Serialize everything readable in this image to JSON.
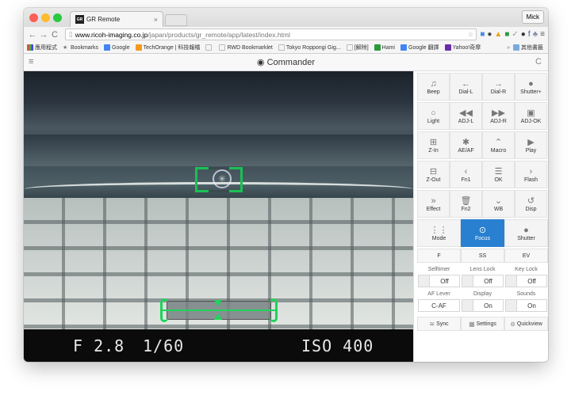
{
  "browser": {
    "tab_title": "GR Remote",
    "tab_favicon": "GR",
    "user": "Mick",
    "url_host": "www.ricoh-imaging.co.jp",
    "url_path": "/japan/products/gr_remote/app/latest/index.html",
    "bookmarks": [
      "應用程式",
      "Bookmarks",
      "Google",
      "TechOrange | 科技報橘",
      "",
      "RWD Bookmarklet",
      "Tokyo Roppongi Gig...",
      "[解除]",
      "Hami",
      "Google 翻譯",
      "Yahoo!奇摩",
      "其他書籤"
    ]
  },
  "app": {
    "title": "Commander"
  },
  "camera": {
    "aperture": "F 2.8",
    "shutter": "1/60",
    "iso": "ISO 400"
  },
  "controls": {
    "rows": [
      [
        {
          "label": "Beep",
          "icon": "bell-icon"
        },
        {
          "label": "Dial-L",
          "icon": "arrow-left-icon"
        },
        {
          "label": "Dial-R",
          "icon": "arrow-right-icon"
        },
        {
          "label": "Shutter+",
          "icon": "circle-icon"
        }
      ],
      [
        {
          "label": "Light",
          "icon": "bulb-icon"
        },
        {
          "label": "ADJ-L",
          "icon": "rewind-icon"
        },
        {
          "label": "ADJ-R",
          "icon": "fast-forward-icon"
        },
        {
          "label": "ADJ-OK",
          "icon": "square-down-icon"
        }
      ],
      [
        {
          "label": "Z-In",
          "icon": "plus-square-icon"
        },
        {
          "label": "AE/AF",
          "icon": "asterisk-icon"
        },
        {
          "label": "Macro",
          "icon": "chevron-up-icon"
        },
        {
          "label": "Play",
          "icon": "play-icon"
        }
      ],
      [
        {
          "label": "Z-Out",
          "icon": "minus-square-icon"
        },
        {
          "label": "Fn1",
          "icon": "chevron-left-icon"
        },
        {
          "label": "OK",
          "icon": "list-icon"
        },
        {
          "label": "Flash",
          "icon": "chevron-right-icon"
        }
      ],
      [
        {
          "label": "Effect",
          "icon": "double-chevron-icon"
        },
        {
          "label": "Fn2",
          "icon": "trash-icon"
        },
        {
          "label": "WB",
          "icon": "chevron-down-icon"
        },
        {
          "label": "Disp",
          "icon": "undo-icon"
        }
      ],
      [
        {
          "label": "Mode",
          "icon": "grid-icon"
        },
        {
          "label": "Focus",
          "icon": "target-icon"
        },
        {
          "label": "Shutter",
          "icon": "circle-icon"
        }
      ]
    ],
    "exposure": [
      "F",
      "SS",
      "EV"
    ],
    "toggles": [
      {
        "label": "Selftimer",
        "value": "Off"
      },
      {
        "label": "Lens Lock",
        "value": "Off"
      },
      {
        "label": "Key Lock",
        "value": "Off"
      },
      {
        "label": "AF Lever",
        "value": "C-AF"
      },
      {
        "label": "Display",
        "value": "On"
      },
      {
        "label": "Sounds",
        "value": "On"
      }
    ],
    "bottom": [
      {
        "label": "Sync",
        "icon": "wifi-icon"
      },
      {
        "label": "Settings",
        "icon": "settings-icon"
      },
      {
        "label": "Quickview",
        "icon": "quickview-icon"
      }
    ]
  }
}
